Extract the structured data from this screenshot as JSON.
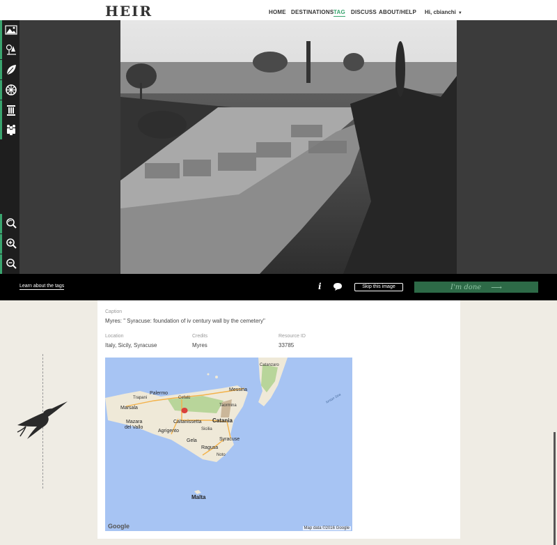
{
  "header": {
    "logo": "HEIR",
    "nav": [
      "HOME",
      "DESTINATIONS",
      "TAG",
      "DISCUSS",
      "ABOUT/HELP"
    ],
    "active": "TAG",
    "user": "Hi, cbianchi"
  },
  "tools": {
    "top": [
      "landscape-icon",
      "plant-icon",
      "leaf-icon",
      "wheel-icon",
      "column-icon",
      "people-icon"
    ],
    "bottom": [
      "reset-zoom-icon",
      "zoom-in-icon",
      "zoom-out-icon"
    ]
  },
  "actionbar": {
    "learn": "Learn about the tags",
    "info": "i",
    "skip": "Skip this image",
    "done": "I'm done",
    "done_arrow": "⟶"
  },
  "details": {
    "caption_label": "Caption",
    "caption": "Myres: \" Syracuse: foundation of iv century wall by the cemetery\"",
    "location_label": "Location",
    "location": "Italy, Sicily, Syracuse",
    "credits_label": "Credits",
    "credits": "Myres",
    "resource_label": "Resource ID",
    "resource": "33785"
  },
  "map": {
    "places": {
      "palermo": "Palermo",
      "messina": "Messina",
      "catania": "Catania",
      "caltanissetta": "Caltanissetta",
      "agrigento": "Agrigento",
      "syracuse": "Syracuse",
      "malta": "Malta",
      "trapani": "Trapani",
      "marsala": "Marsala",
      "mazara": "Mazara",
      "mazara2": "del Vallo",
      "taormina": "Taormina",
      "catanzaro": "Catanzaro",
      "gela": "Gela",
      "ragusa": "Ragusa",
      "noto": "Noto",
      "sicilia": "Sicilia",
      "cefalu": "Cefalù",
      "ionian": "Ionian Sea"
    },
    "brand": "Google",
    "attribution": "Map data ©2016 Google"
  }
}
